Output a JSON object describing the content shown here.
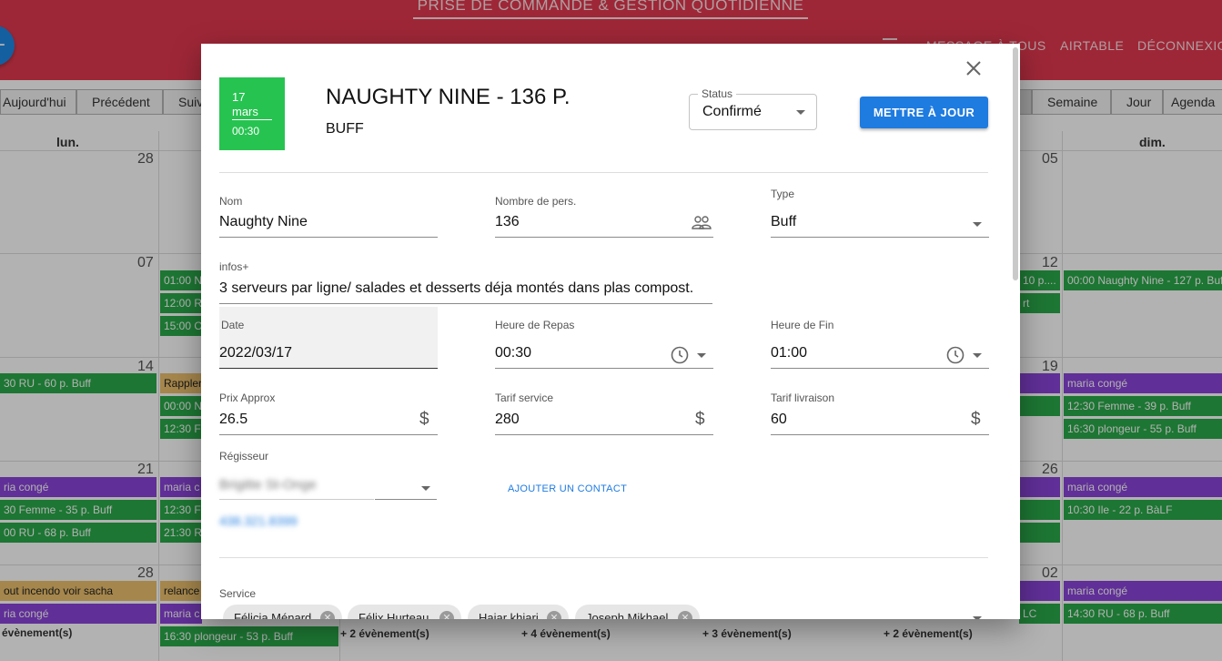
{
  "app": {
    "title": "PRISE DE COMMANDE & GESTION QUOTIDIENNE",
    "fab_icon": "+",
    "nav": {
      "message": "MESSAGE À TOUS",
      "airtable": "AIRTABLE",
      "logout": "DÉCONNEXIO"
    },
    "toolbar": {
      "today": "Aujourd'hui",
      "previous": "Précédent",
      "next": "Suiv",
      "week": "Semaine",
      "day": "Jour",
      "agenda": "Agenda"
    },
    "calendar": {
      "day_headers": {
        "mon": "lun.",
        "sun": "dim."
      },
      "day_numbers": [
        "28",
        "05",
        "07",
        "12",
        "14",
        "19",
        "21",
        "26",
        "28",
        "02"
      ],
      "events": [
        "01:00 N",
        "12:00 R",
        "15:00 O",
        "10 p....",
        "rt",
        "00:00 Naughty Nine - 127 p. Buff",
        "30 RU - 60 p. Buff",
        "Rappler",
        "00:00 N",
        "12:30 F",
        "maria congé",
        "12:30 Femme - 39 p. Buff",
        "16:30 plongeur - 55 p. Buff",
        "ria congé",
        "30 Femme - 35 p. Buff",
        "00 RU - 68 p. Buff",
        "maria c",
        "12:30 F",
        "21:30 R",
        "maria congé",
        "10:30 Ile - 22 p. BàLF",
        "out incendo voir sacha",
        "ria congé",
        "relance",
        "maria c",
        "16:30 plongeur - 53 p. Buff",
        "LC",
        "maria congé",
        "14:30 RU - 68 p. Buff"
      ],
      "more_links": [
        "évènement(s)",
        "+ 2 évènement(s)",
        "+ 4 évènement(s)",
        "+ 3 évènement(s)",
        "+ 2 évènement(s)"
      ]
    }
  },
  "dialog": {
    "close_icon": "close-icon",
    "badge": {
      "day": "17",
      "month": "mars",
      "time": "00:30",
      "color": "#27c351"
    },
    "title": "NAUGHTY NINE - 136 P.",
    "subtitle": "BUFF",
    "status": {
      "label": "Status",
      "value": "Confirmé"
    },
    "update_button": "METTRE À JOUR",
    "fields": {
      "nom": {
        "label": "Nom",
        "value": "Naughty Nine"
      },
      "nombre": {
        "label": "Nombre de pers.",
        "value": "136"
      },
      "type": {
        "label": "Type",
        "value": "Buff"
      },
      "infos": {
        "label": "infos+",
        "value": "3 serveurs par ligne/ salades et desserts déja montés dans plas compost."
      },
      "date": {
        "label": "Date",
        "value": "2022/03/17"
      },
      "heure_repas": {
        "label": "Heure de Repas",
        "value": "00:30"
      },
      "heure_fin": {
        "label": "Heure de Fin",
        "value": "01:00"
      },
      "prix": {
        "label": "Prix Approx",
        "value": "26.5"
      },
      "tarif_service": {
        "label": "Tarif service",
        "value": "280"
      },
      "tarif_livraison": {
        "label": "Tarif livraison",
        "value": "60"
      },
      "regisseur": {
        "label": "Régisseur",
        "value": "Brigitte St-Onge",
        "phone": "438.321.8399"
      }
    },
    "currency_symbol": "$",
    "add_contact": "AJOUTER UN CONTACT",
    "service": {
      "label": "Service",
      "chips": [
        "Félicia Ménard",
        "Félix Hurteau",
        "Hajar khiari",
        "Joseph Mikhael"
      ]
    },
    "colors": {
      "accent": "#1e7be0",
      "header_red": "#e2394f",
      "event_green": "#2aaa49",
      "event_purple": "#8a44d8"
    }
  }
}
